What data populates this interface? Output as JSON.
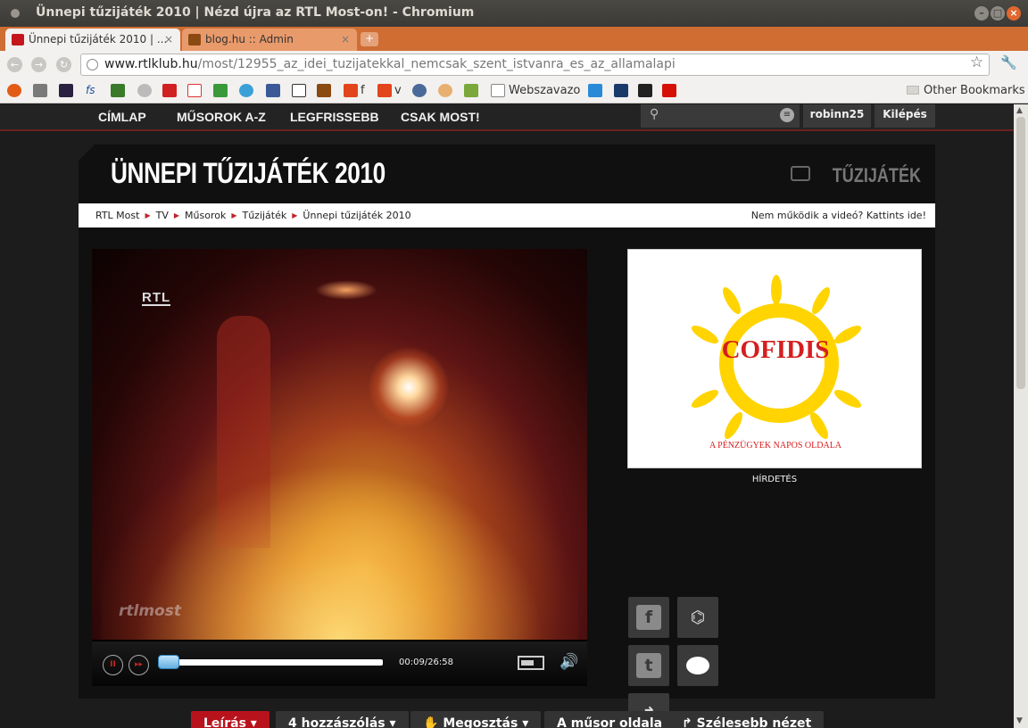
{
  "window": {
    "title": "Ünnepi tűzijáték 2010 | Nézd újra az RTL Most-on! - Chromium"
  },
  "tabs": [
    {
      "label": "Ünnepi tűzijáték 2010 | ...",
      "close": "×",
      "favicon_color": "#c4161c"
    },
    {
      "label": "blog.hu :: Admin",
      "close": "×",
      "favicon_color": "#8a4a12"
    }
  ],
  "new_tab_symbol": "+",
  "url": {
    "host": "www.rtlklub.hu",
    "path": "/most/12955_az_idei_tuzijatekkal_nemcsak_szent_istvanra_es_az_allamalapi"
  },
  "bookmarks": {
    "icons": [
      "ubuntu-icon",
      "bookmark-icon",
      "game-icon",
      "fs-icon",
      "chess-icon",
      "moon-icon",
      "youtube-icon",
      "gmail-icon",
      "puzzle-icon",
      "twitter-icon",
      "facebook-icon",
      "ci-icon",
      "blog-icon",
      "tf-icon",
      "iv-icon",
      "steam-icon",
      "face-icon",
      "chart-icon",
      "page-icon",
      "play-icon",
      "pixel-icon",
      "cat-icon",
      "lastfm-icon"
    ],
    "labels": {
      "tf": "f",
      "iv": "v",
      "webszavazo": "Webszavazo"
    },
    "other": "Other Bookmarks"
  },
  "site_nav": {
    "items": [
      "CÍMLAP",
      "MŰSOROK A-Z",
      "LEGFRISSEBB",
      "CSAK MOST!"
    ],
    "user": "robinn25",
    "logout": "Kilépés"
  },
  "header": {
    "title": "ÜNNEPI TŰZIJÁTÉK 2010",
    "category": "TŰZIJÁTÉK"
  },
  "breadcrumb": {
    "items": [
      "RTL Most",
      "TV",
      "Műsorok",
      "Tűzijáték",
      "Ünnepi tűzijáték 2010"
    ],
    "help": "Nem működik a videó? Kattints ide!"
  },
  "player": {
    "channel_logo": "RTL",
    "watermark": "rtlmost",
    "time": "00:09/26:58",
    "progress_fraction": 0.006
  },
  "ad": {
    "brand": "COFIDIS",
    "slogan": "A PÉNZÜGYEK NAPOS OLDALA",
    "label": "HÍRDETÉS",
    "sun_color": "#ffd400",
    "text_color": "#d61e1e"
  },
  "social": {
    "facebook": "f",
    "twitter": "t",
    "share": "↱"
  },
  "bottom_tabs": [
    "Leírás",
    "4 hozzászólás",
    "Megosztás",
    "A műsor oldala",
    "Szélesebb nézet"
  ]
}
